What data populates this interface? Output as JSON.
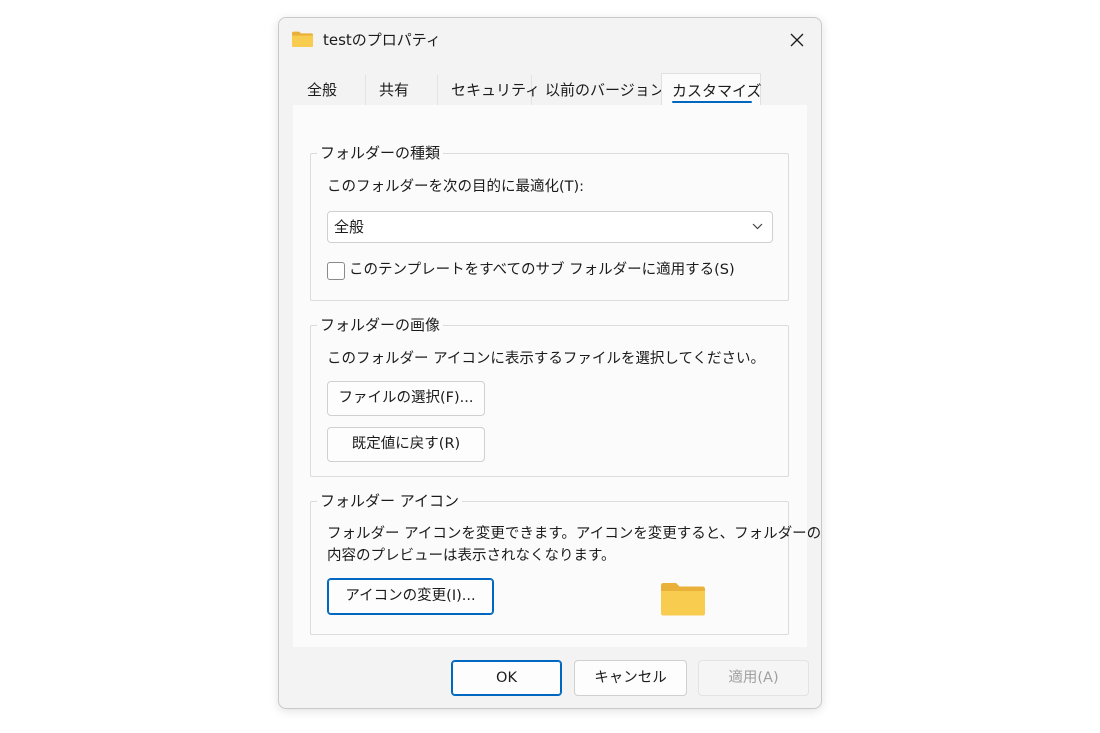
{
  "window": {
    "title": "testのプロパティ",
    "close_icon": "close-icon",
    "title_icon": "folder-icon"
  },
  "tabs": [
    {
      "label": "全般",
      "active": false
    },
    {
      "label": "共有",
      "active": false
    },
    {
      "label": "セキュリティ",
      "active": false
    },
    {
      "label": "以前のバージョン",
      "active": false
    },
    {
      "label": "カスタマイズ",
      "active": true
    }
  ],
  "folder_type": {
    "legend": "フォルダーの種類",
    "optimize_label": "このフォルダーを次の目的に最適化(T):",
    "optimize_value": "全般",
    "apply_template_label": "このテンプレートをすべてのサブ フォルダーに適用する(S)",
    "apply_template_checked": false
  },
  "folder_picture": {
    "legend": "フォルダーの画像",
    "description": "このフォルダー アイコンに表示するファイルを選択してください。",
    "choose_file_label": "ファイルの選択(F)...",
    "restore_default_label": "既定値に戻す(R)"
  },
  "folder_icon": {
    "legend": "フォルダー アイコン",
    "description_line1": "フォルダー アイコンを変更できます。アイコンを変更すると、フォルダーの",
    "description_line2": "内容のプレビューは表示されなくなります。",
    "change_icon_label": "アイコンの変更(I)..."
  },
  "footer": {
    "ok_label": "OK",
    "cancel_label": "キャンセル",
    "apply_label": "適用(A)",
    "apply_enabled": false
  },
  "colors": {
    "accent": "#0067c0",
    "folder_yellow": "#f8cd4f",
    "folder_dark": "#eab13a"
  }
}
